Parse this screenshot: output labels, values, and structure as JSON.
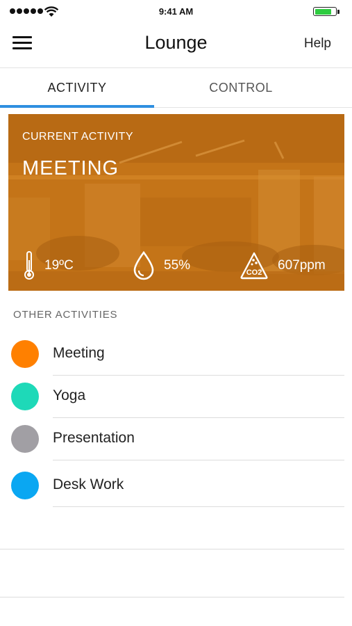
{
  "status_bar": {
    "time": "9:41 AM"
  },
  "nav": {
    "title": "Lounge",
    "help_label": "Help",
    "menu_icon": "hamburger-menu-icon"
  },
  "tabs": [
    {
      "label": "ACTIVITY",
      "active": true
    },
    {
      "label": "CONTROL",
      "active": false
    }
  ],
  "current_activity": {
    "label": "CURRENT ACTIVITY",
    "name": "MEETING",
    "temperature": "19ºC",
    "humidity": "55%",
    "co2": "607ppm",
    "co2_icon_text": "CO2",
    "card_color": "#c47418"
  },
  "other_activities": {
    "header": "OTHER ACTIVITIES",
    "items": [
      {
        "label": "Meeting",
        "color": "#ff8000"
      },
      {
        "label": "Yoga",
        "color": "#1ed9b8"
      },
      {
        "label": "Presentation",
        "color": "#a19fa4"
      },
      {
        "label": "Desk Work",
        "color": "#0aa7f2"
      }
    ]
  },
  "colors": {
    "tab_indicator": "#2f8fe0",
    "battery": "#2ecc40"
  }
}
